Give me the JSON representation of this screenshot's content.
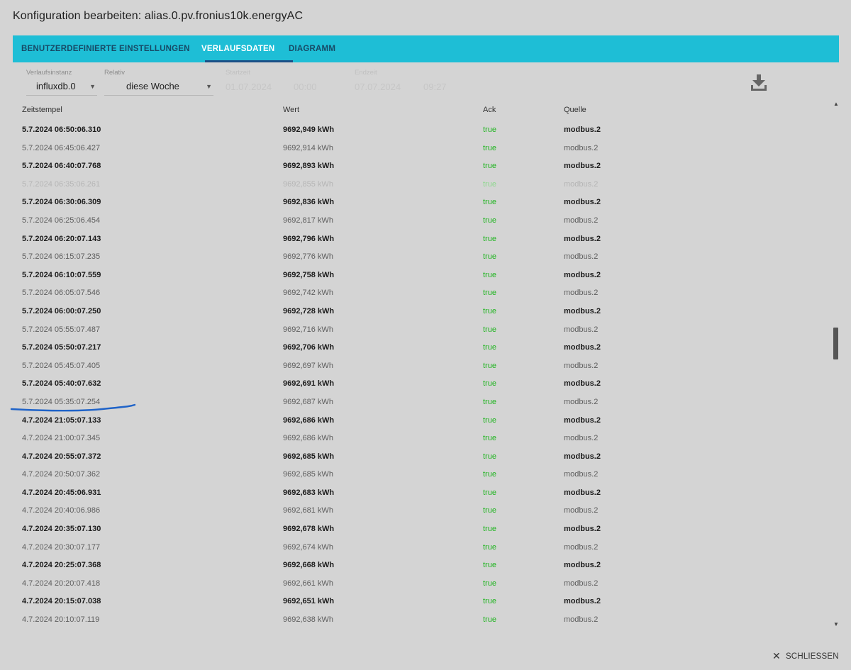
{
  "dialog": {
    "title": "Konfiguration bearbeiten: alias.0.pv.fronius10k.energyAC",
    "close_label": "SCHLIESSEN"
  },
  "tabs": [
    {
      "label": "BENUTZERDEFINIERTE EINSTELLUNGEN",
      "active": false
    },
    {
      "label": "VERLAUFSDATEN",
      "active": true
    },
    {
      "label": "DIAGRAMM",
      "active": false
    }
  ],
  "controls": {
    "instance": {
      "label": "Verlaufsinstanz",
      "value": "influxdb.0"
    },
    "relative": {
      "label": "Relativ",
      "value": "diese Woche"
    },
    "start": {
      "label": "Startzeit",
      "date": "01.07.2024",
      "time": "00:00"
    },
    "end": {
      "label": "Endzeit",
      "date": "07.07.2024",
      "time": "09:27"
    }
  },
  "table": {
    "headers": {
      "timestamp": "Zeitstempel",
      "value": "Wert",
      "ack": "Ack",
      "source": "Quelle"
    },
    "rows": [
      {
        "ts": "5.7.2024 06:50:06.310",
        "val": "9692,949 kWh",
        "ack": "true",
        "src": "modbus.2",
        "style": "bold"
      },
      {
        "ts": "5.7.2024 06:45:06.427",
        "val": "9692,914 kWh",
        "ack": "true",
        "src": "modbus.2",
        "style": "light"
      },
      {
        "ts": "5.7.2024 06:40:07.768",
        "val": "9692,893 kWh",
        "ack": "true",
        "src": "modbus.2",
        "style": "bold"
      },
      {
        "ts": "5.7.2024 06:35:06.261",
        "val": "9692,855 kWh",
        "ack": "true",
        "src": "modbus.2",
        "style": "faded"
      },
      {
        "ts": "5.7.2024 06:30:06.309",
        "val": "9692,836 kWh",
        "ack": "true",
        "src": "modbus.2",
        "style": "bold"
      },
      {
        "ts": "5.7.2024 06:25:06.454",
        "val": "9692,817 kWh",
        "ack": "true",
        "src": "modbus.2",
        "style": "light"
      },
      {
        "ts": "5.7.2024 06:20:07.143",
        "val": "9692,796 kWh",
        "ack": "true",
        "src": "modbus.2",
        "style": "bold"
      },
      {
        "ts": "5.7.2024 06:15:07.235",
        "val": "9692,776 kWh",
        "ack": "true",
        "src": "modbus.2",
        "style": "light"
      },
      {
        "ts": "5.7.2024 06:10:07.559",
        "val": "9692,758 kWh",
        "ack": "true",
        "src": "modbus.2",
        "style": "bold"
      },
      {
        "ts": "5.7.2024 06:05:07.546",
        "val": "9692,742 kWh",
        "ack": "true",
        "src": "modbus.2",
        "style": "light"
      },
      {
        "ts": "5.7.2024 06:00:07.250",
        "val": "9692,728 kWh",
        "ack": "true",
        "src": "modbus.2",
        "style": "bold"
      },
      {
        "ts": "5.7.2024 05:55:07.487",
        "val": "9692,716 kWh",
        "ack": "true",
        "src": "modbus.2",
        "style": "light"
      },
      {
        "ts": "5.7.2024 05:50:07.217",
        "val": "9692,706 kWh",
        "ack": "true",
        "src": "modbus.2",
        "style": "bold"
      },
      {
        "ts": "5.7.2024 05:45:07.405",
        "val": "9692,697 kWh",
        "ack": "true",
        "src": "modbus.2",
        "style": "light"
      },
      {
        "ts": "5.7.2024 05:40:07.632",
        "val": "9692,691 kWh",
        "ack": "true",
        "src": "modbus.2",
        "style": "bold"
      },
      {
        "ts": "5.7.2024 05:35:07.254",
        "val": "9692,687 kWh",
        "ack": "true",
        "src": "modbus.2",
        "style": "light"
      },
      {
        "ts": "4.7.2024 21:05:07.133",
        "val": "9692,686 kWh",
        "ack": "true",
        "src": "modbus.2",
        "style": "bold"
      },
      {
        "ts": "4.7.2024 21:00:07.345",
        "val": "9692,686 kWh",
        "ack": "true",
        "src": "modbus.2",
        "style": "light"
      },
      {
        "ts": "4.7.2024 20:55:07.372",
        "val": "9692,685 kWh",
        "ack": "true",
        "src": "modbus.2",
        "style": "bold"
      },
      {
        "ts": "4.7.2024 20:50:07.362",
        "val": "9692,685 kWh",
        "ack": "true",
        "src": "modbus.2",
        "style": "light"
      },
      {
        "ts": "4.7.2024 20:45:06.931",
        "val": "9692,683 kWh",
        "ack": "true",
        "src": "modbus.2",
        "style": "bold"
      },
      {
        "ts": "4.7.2024 20:40:06.986",
        "val": "9692,681 kWh",
        "ack": "true",
        "src": "modbus.2",
        "style": "light"
      },
      {
        "ts": "4.7.2024 20:35:07.130",
        "val": "9692,678 kWh",
        "ack": "true",
        "src": "modbus.2",
        "style": "bold"
      },
      {
        "ts": "4.7.2024 20:30:07.177",
        "val": "9692,674 kWh",
        "ack": "true",
        "src": "modbus.2",
        "style": "light"
      },
      {
        "ts": "4.7.2024 20:25:07.368",
        "val": "9692,668 kWh",
        "ack": "true",
        "src": "modbus.2",
        "style": "bold"
      },
      {
        "ts": "4.7.2024 20:20:07.418",
        "val": "9692,661 kWh",
        "ack": "true",
        "src": "modbus.2",
        "style": "light"
      },
      {
        "ts": "4.7.2024 20:15:07.038",
        "val": "9692,651 kWh",
        "ack": "true",
        "src": "modbus.2",
        "style": "bold"
      },
      {
        "ts": "4.7.2024 20:10:07.119",
        "val": "9692,638 kWh",
        "ack": "true",
        "src": "modbus.2",
        "style": "light"
      }
    ]
  },
  "icons": {
    "download": "download-icon",
    "close": "close-icon",
    "dropdown": "chevron-down-icon"
  },
  "colors": {
    "tab_bar": "#1ebed6",
    "tab_indicator": "#1a4f86",
    "ack_true": "#22b522",
    "annotation_stroke": "#1f63c8"
  }
}
